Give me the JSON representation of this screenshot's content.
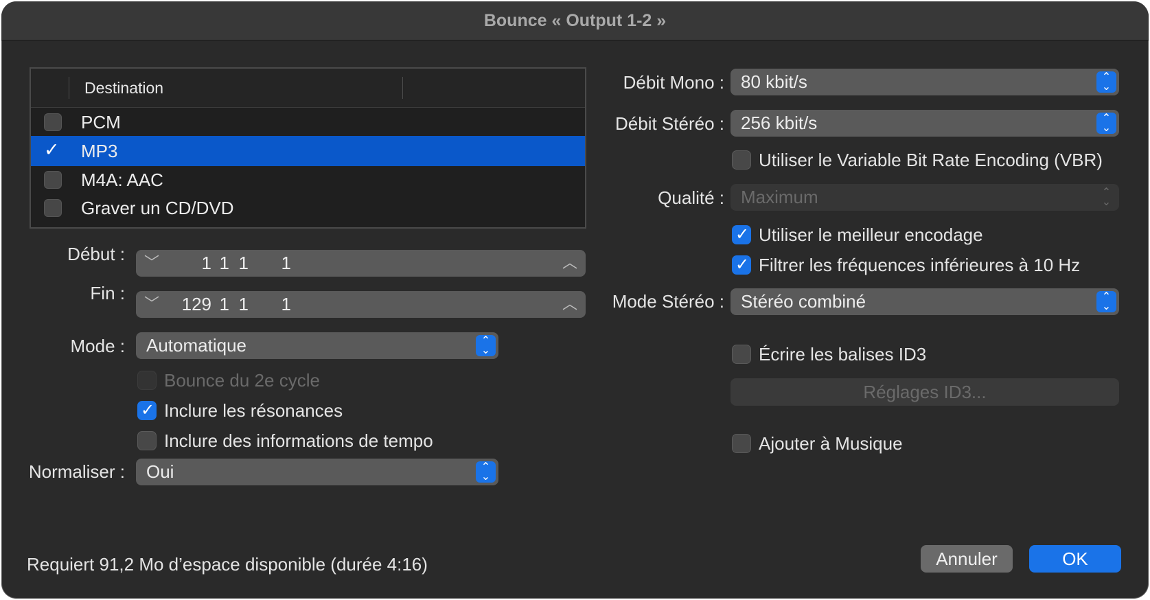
{
  "window": {
    "title": "Bounce « Output 1-2 »"
  },
  "destination": {
    "header": "Destination",
    "rows": [
      {
        "label": "PCM",
        "checked": false
      },
      {
        "label": "MP3",
        "checked": true
      },
      {
        "label": "M4A: AAC",
        "checked": false
      },
      {
        "label": "Graver un CD/DVD",
        "checked": false
      }
    ]
  },
  "left": {
    "debut": {
      "label": "Début :",
      "bars": "1",
      "beats": "1",
      "div": "1",
      "ticks": "1"
    },
    "fin": {
      "label": "Fin :",
      "bars": "129",
      "beats": "1",
      "div": "1",
      "ticks": "1"
    },
    "mode": {
      "label": "Mode :",
      "value": "Automatique"
    },
    "bounce2": {
      "label": "Bounce du 2e cycle",
      "checked": false,
      "enabled": false
    },
    "resonances": {
      "label": "Inclure les résonances",
      "checked": true
    },
    "tempo": {
      "label": "Inclure des informations de tempo",
      "checked": false
    },
    "normaliser": {
      "label": "Normaliser :",
      "value": "Oui"
    }
  },
  "right": {
    "debit_mono": {
      "label": "Débit Mono :",
      "value": "80 kbit/s"
    },
    "debit_stereo": {
      "label": "Débit Stéréo :",
      "value": "256 kbit/s"
    },
    "vbr": {
      "label": "Utiliser le Variable Bit Rate Encoding (VBR)",
      "checked": false
    },
    "qualite": {
      "label": "Qualité :",
      "value": "Maximum",
      "enabled": false
    },
    "meilleur": {
      "label": "Utiliser le meilleur encodage",
      "checked": true
    },
    "filtrer": {
      "label": "Filtrer les fréquences inférieures à 10 Hz",
      "checked": true
    },
    "mode_stereo": {
      "label": "Mode Stéréo :",
      "value": "Stéréo combiné"
    },
    "id3": {
      "label": "Écrire les balises ID3",
      "checked": false
    },
    "id3_settings": {
      "label": "Réglages ID3..."
    },
    "musique": {
      "label": "Ajouter à Musique",
      "checked": false
    }
  },
  "footer": {
    "status": "Requiert 91,2 Mo d’espace disponible (durée 4:16)",
    "cancel": "Annuler",
    "ok": "OK"
  },
  "colors": {
    "accent": "#1a73e8",
    "selection": "#0a58ca",
    "background": "#2a2a2a"
  }
}
